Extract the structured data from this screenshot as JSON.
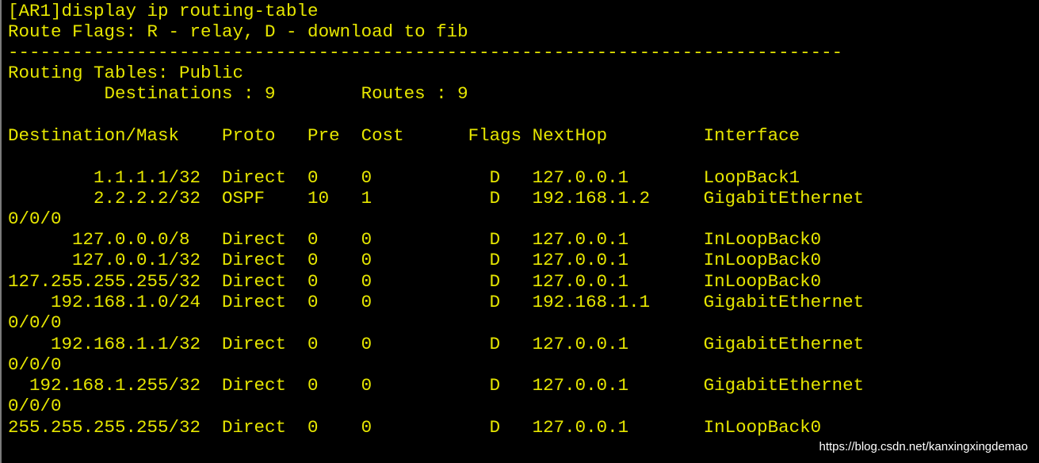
{
  "terminal": {
    "lines": [
      "[AR1]display ip routing-table",
      "Route Flags: R - relay, D - download to fib",
      "------------------------------------------------------------------------------",
      "Routing Tables: Public",
      "         Destinations : 9        Routes : 9",
      "",
      "Destination/Mask    Proto   Pre  Cost      Flags NextHop         Interface",
      "",
      "        1.1.1.1/32  Direct  0    0           D   127.0.0.1       LoopBack1",
      "        2.2.2.2/32  OSPF    10   1           D   192.168.1.2     GigabitEthernet",
      "0/0/0",
      "      127.0.0.0/8   Direct  0    0           D   127.0.0.1       InLoopBack0",
      "      127.0.0.1/32  Direct  0    0           D   127.0.0.1       InLoopBack0",
      "127.255.255.255/32  Direct  0    0           D   127.0.0.1       InLoopBack0",
      "    192.168.1.0/24  Direct  0    0           D   192.168.1.1     GigabitEthernet",
      "0/0/0",
      "    192.168.1.1/32  Direct  0    0           D   127.0.0.1       GigabitEthernet",
      "0/0/0",
      "  192.168.1.255/32  Direct  0    0           D   127.0.0.1       GigabitEthernet",
      "0/0/0",
      "255.255.255.255/32  Direct  0    0           D   127.0.0.1       InLoopBack0"
    ],
    "text_color": "#e6e600",
    "background_color": "#000000"
  },
  "watermark": "https://blog.csdn.net/kanxingxingdemao"
}
